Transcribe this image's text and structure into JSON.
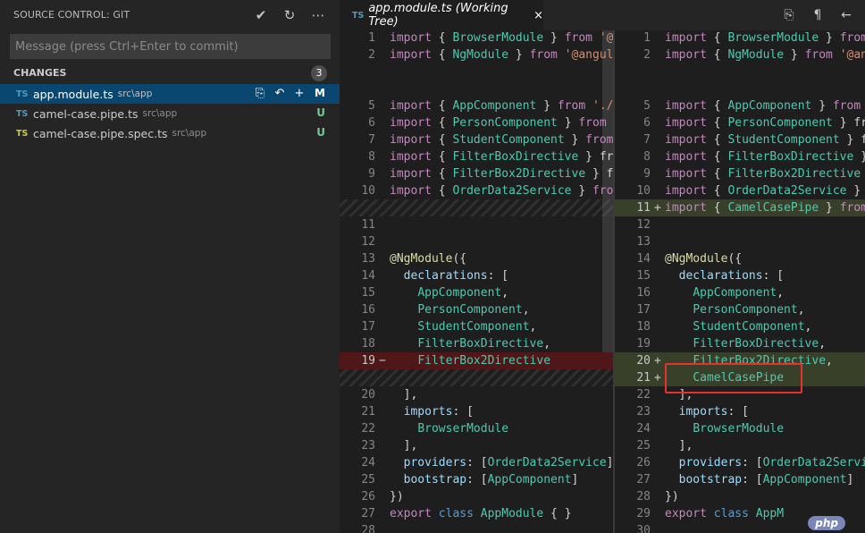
{
  "sidebar": {
    "title": "SOURCE CONTROL: GIT",
    "actions": [
      {
        "name": "commit-icon",
        "glyph": "✔"
      },
      {
        "name": "refresh-icon",
        "glyph": "↻"
      },
      {
        "name": "more-icon",
        "glyph": "⋯"
      }
    ],
    "commit_placeholder": "Message (press Ctrl+Enter to commit)",
    "changes_label": "CHANGES",
    "changes_count": "3",
    "files": [
      {
        "badge": "TS",
        "badge_color": "#519aba",
        "name": "app.module.ts",
        "dir": "src\\app",
        "status": "M",
        "selected": true
      },
      {
        "badge": "TS",
        "badge_color": "#519aba",
        "name": "camel-case.pipe.ts",
        "dir": "src\\app",
        "status": "U",
        "selected": false
      },
      {
        "badge": "TS",
        "badge_color": "#cbcb41",
        "name": "camel-case.pipe.spec.ts",
        "dir": "src\\app",
        "status": "U",
        "selected": false
      }
    ],
    "file_action_icons": [
      "open-file-icon",
      "discard-icon",
      "stage-icon"
    ]
  },
  "editor": {
    "tab": {
      "badge": "TS",
      "title": "app.module.ts (Working Tree)",
      "close": "×"
    },
    "actions": [
      {
        "name": "open-file-icon",
        "glyph": "⎘"
      },
      {
        "name": "whitespace-icon",
        "glyph": "¶"
      },
      {
        "name": "back-icon",
        "glyph": "←"
      }
    ],
    "left_lines": [
      {
        "n": "1",
        "code": "import { BrowserModule } from '@a"
      },
      {
        "n": "2",
        "code": "import { NgModule } from '@angula"
      },
      {
        "n": "",
        "code": ""
      },
      {
        "n": "",
        "code": ""
      },
      {
        "n": "5",
        "code": "import { AppComponent } from './a"
      },
      {
        "n": "6",
        "code": "import { PersonComponent } from '"
      },
      {
        "n": "7",
        "code": "import { StudentComponent } from"
      },
      {
        "n": "8",
        "code": "import { FilterBoxDirective } fro"
      },
      {
        "n": "9",
        "code": "import { FilterBox2Directive } fr"
      },
      {
        "n": "10",
        "code": "import { OrderData2Service } from"
      },
      {
        "n": "",
        "code": "",
        "filler": true
      },
      {
        "n": "11",
        "code": ""
      },
      {
        "n": "12",
        "code": ""
      },
      {
        "n": "13",
        "code": "@NgModule({"
      },
      {
        "n": "14",
        "code": "  declarations: ["
      },
      {
        "n": "15",
        "code": "    AppComponent,"
      },
      {
        "n": "16",
        "code": "    PersonComponent,"
      },
      {
        "n": "17",
        "code": "    StudentComponent,"
      },
      {
        "n": "18",
        "code": "    FilterBoxDirective,"
      },
      {
        "n": "19",
        "code": "    FilterBox2Directive",
        "marker": "−",
        "deleted": true
      },
      {
        "n": "",
        "code": "",
        "filler": true
      },
      {
        "n": "20",
        "code": "  ],"
      },
      {
        "n": "21",
        "code": "  imports: ["
      },
      {
        "n": "22",
        "code": "    BrowserModule"
      },
      {
        "n": "23",
        "code": "  ],"
      },
      {
        "n": "24",
        "code": "  providers: [OrderData2Service],"
      },
      {
        "n": "25",
        "code": "  bootstrap: [AppComponent]"
      },
      {
        "n": "26",
        "code": "})"
      },
      {
        "n": "27",
        "code": "export class AppModule { }"
      },
      {
        "n": "28",
        "code": ""
      }
    ],
    "right_lines": [
      {
        "n": "1",
        "code": "import { BrowserModule } from"
      },
      {
        "n": "2",
        "code": "import { NgModule } from '@an"
      },
      {
        "n": "",
        "code": ""
      },
      {
        "n": "",
        "code": ""
      },
      {
        "n": "5",
        "code": "import { AppComponent } from"
      },
      {
        "n": "6",
        "code": "import { PersonComponent } fr"
      },
      {
        "n": "7",
        "code": "import { StudentComponent } f"
      },
      {
        "n": "8",
        "code": "import { FilterBoxDirective }"
      },
      {
        "n": "9",
        "code": "import { FilterBox2Directive"
      },
      {
        "n": "10",
        "code": "import { OrderData2Service }"
      },
      {
        "n": "11",
        "code": "import { CamelCasePipe } from",
        "marker": "+",
        "inserted": true
      },
      {
        "n": "12",
        "code": ""
      },
      {
        "n": "13",
        "code": ""
      },
      {
        "n": "14",
        "code": "@NgModule({"
      },
      {
        "n": "15",
        "code": "  declarations: ["
      },
      {
        "n": "16",
        "code": "    AppComponent,"
      },
      {
        "n": "17",
        "code": "    PersonComponent,"
      },
      {
        "n": "18",
        "code": "    StudentComponent,"
      },
      {
        "n": "19",
        "code": "    FilterBoxDirective,"
      },
      {
        "n": "20",
        "code": "    FilterBox2Directive,",
        "marker": "+",
        "inserted": true
      },
      {
        "n": "21",
        "code": "    CamelCasePipe",
        "marker": "+",
        "inserted": true
      },
      {
        "n": "22",
        "code": "  ],"
      },
      {
        "n": "23",
        "code": "  imports: ["
      },
      {
        "n": "24",
        "code": "    BrowserModule"
      },
      {
        "n": "25",
        "code": "  ],"
      },
      {
        "n": "26",
        "code": "  providers: [OrderData2Servi"
      },
      {
        "n": "27",
        "code": "  bootstrap: [AppComponent]"
      },
      {
        "n": "28",
        "code": "})"
      },
      {
        "n": "29",
        "code": "export class AppM"
      },
      {
        "n": "30",
        "code": ""
      }
    ]
  },
  "watermark": "php"
}
